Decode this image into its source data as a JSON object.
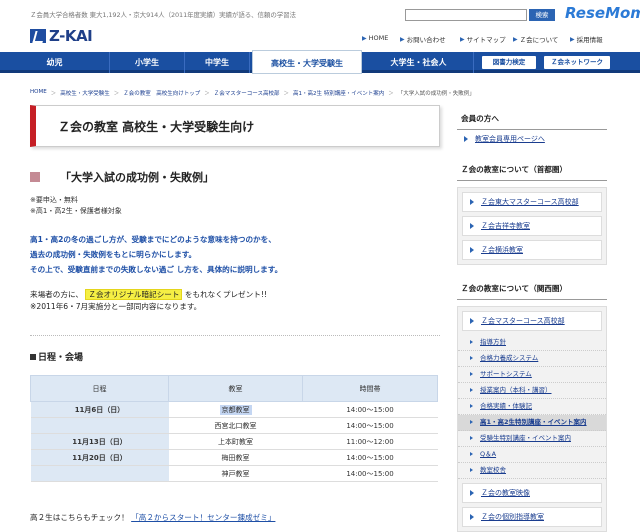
{
  "header": {
    "tagline": "Ｚ会員大学合格者数 東大1,192人・京大914人（2011年度実績）実績が語る、信頼の学習法",
    "search_button": "検索",
    "watermark": "ReseMom",
    "logo_text": "Z-KAI",
    "utility": [
      "HOME",
      "お問い合わせ",
      "サイトマップ",
      "Ｚ会について",
      "採用情報"
    ]
  },
  "nav": {
    "items": [
      "幼児",
      "小学生",
      "中学生",
      "高校生・大学受験生",
      "大学生・社会人"
    ],
    "active": "高校生・大学受験生",
    "badges": [
      "図書力検定",
      "Ｚ会ネットワーク"
    ]
  },
  "breadcrumb": [
    "HOME",
    "高校生・大学受験生",
    "Ｚ会の教室　高校生向けトップ",
    "Ｚ会マスターコース高校部",
    "高1・高2生 特別講座・イベント案内",
    "「大学入試の成功例・失敗例」"
  ],
  "main": {
    "page_title": "Ｚ会の教室 高校生・大学受験生向け",
    "section_title": "「大学入試の成功例・失敗例」",
    "notes": [
      "※要申込・無料",
      "※高1・高2生・保護者様対象"
    ],
    "lead": [
      "高1・高2の冬の過ごし方が、受験までにどのような意味を持つのかを、",
      "過去の成功例・失敗例をもとに明らかにします。",
      "その上で、受験直前までの失敗しない過ご し方を、具体的に説明します。"
    ],
    "present_pre": "来場者の方に、",
    "present_hl": "Ｚ会オリジナル暗記シート",
    "present_post": "をもれなくプレゼント!!",
    "present_note": "※2011年6・7月実施分と一部同内容になります。",
    "schedule_title": "日程・会場",
    "table_headers": [
      "日程",
      "教室",
      "時間帯"
    ],
    "rows": [
      {
        "date": "11月6日（日）",
        "room": "京都教室",
        "time": "14:00～15:00"
      },
      {
        "date": "",
        "room": "西宮北口教室",
        "time": "14:00～15:00"
      },
      {
        "date": "11月13日（日）",
        "room": "上本町教室",
        "time": "11:00～12:00"
      },
      {
        "date": "11月20日（日）",
        "room": "梅田教室",
        "time": "14:00～15:00"
      },
      {
        "date": "",
        "room": "神戸教室",
        "time": "14:00～15:00"
      }
    ],
    "bottom_pre": "高２生はこちらもチェック！",
    "bottom_link": "「高２からスタート！センター錬成ゼミ」"
  },
  "sidebar": {
    "members_head": "会員の方へ",
    "members_link": "教室会員専用ページへ",
    "tokyo_head": "Ｚ会の教室について（首都圏）",
    "tokyo_links": [
      "Ｚ会東大マスターコース高校部",
      "Ｚ会吉祥寺教室",
      "Ｚ会横浜教室"
    ],
    "kansai_head": "Ｚ会の教室について（関西圏）",
    "kansai_main": "Ｚ会マスターコース高校部",
    "kansai_sub": [
      "指導方針",
      "合格力養成システム",
      "サポートシステム",
      "授業案内（本科・講習）",
      "合格実績・体験記",
      "高1・高2生特別講座・イベント案内",
      "受験生特別講座・イベント案内",
      "Q＆A",
      "教室校舎"
    ],
    "kansai_current": "高1・高2生特別講座・イベント案内",
    "bottom_links": [
      "Ｚ会の教室映像",
      "Ｚ会の個別指導教室"
    ]
  },
  "colors": {
    "brand_blue": "#1a4fa1",
    "accent_red": "#c61f26",
    "highlight": "#f5ef44"
  }
}
